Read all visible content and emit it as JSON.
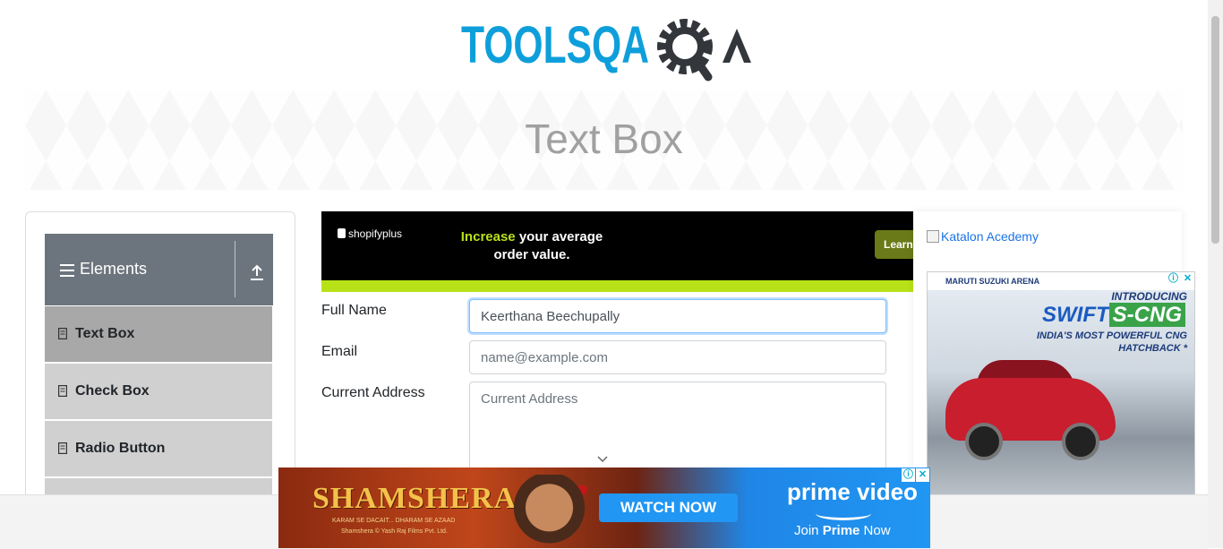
{
  "header": {
    "logo_text": "TOOLSQA"
  },
  "banner": {
    "title": "Text Box"
  },
  "sidebar": {
    "group_title": "Elements",
    "items": [
      {
        "label": "Text Box",
        "active": true
      },
      {
        "label": "Check Box",
        "active": false
      },
      {
        "label": "Radio Button",
        "active": false
      }
    ]
  },
  "ad_top": {
    "brand": "shopifyplus",
    "headline_highlight": "Increase",
    "headline_rest": " your average order value.",
    "cta": "Learn"
  },
  "form": {
    "full_name_label": "Full Name",
    "full_name_value": "Keerthana Beechupally",
    "email_label": "Email",
    "email_placeholder": "name@example.com",
    "address_label": "Current Address",
    "address_placeholder": "Current Address"
  },
  "right_ads": {
    "katalon_alt": "Katalon Acedemy",
    "suzuki": {
      "brand": "MARUTI SUZUKI ARENA",
      "intro": "INTRODUCING",
      "model": "SWIFT",
      "variant": "S-CNG",
      "tagline": "INDIA'S MOST POWERFUL CNG HATCHBACK *"
    }
  },
  "bottom_ad": {
    "movie": "SHAMSHERA",
    "tagline_small": "KARAM SE DACAIT... DHARAM SE AZAAD",
    "copyright": "Shamshera © Yash Raj Films Pvt. Ltd.",
    "cta": "WATCH NOW",
    "service": "prime video",
    "join_prefix": "Join ",
    "join_bold": "Prime",
    "join_suffix": " Now"
  },
  "colors": {
    "logo_blue": "#0e9fdb",
    "logo_dark": "#33363b",
    "group_header_bg": "#6c757d",
    "active_item_bg": "#a8a8a8",
    "item_bg": "#d0d0d0"
  },
  "icons": [
    "hamburger-icon",
    "upload-arrow-icon",
    "document-icon",
    "chevron-down-icon",
    "ad-info-icon",
    "ad-close-icon"
  ]
}
